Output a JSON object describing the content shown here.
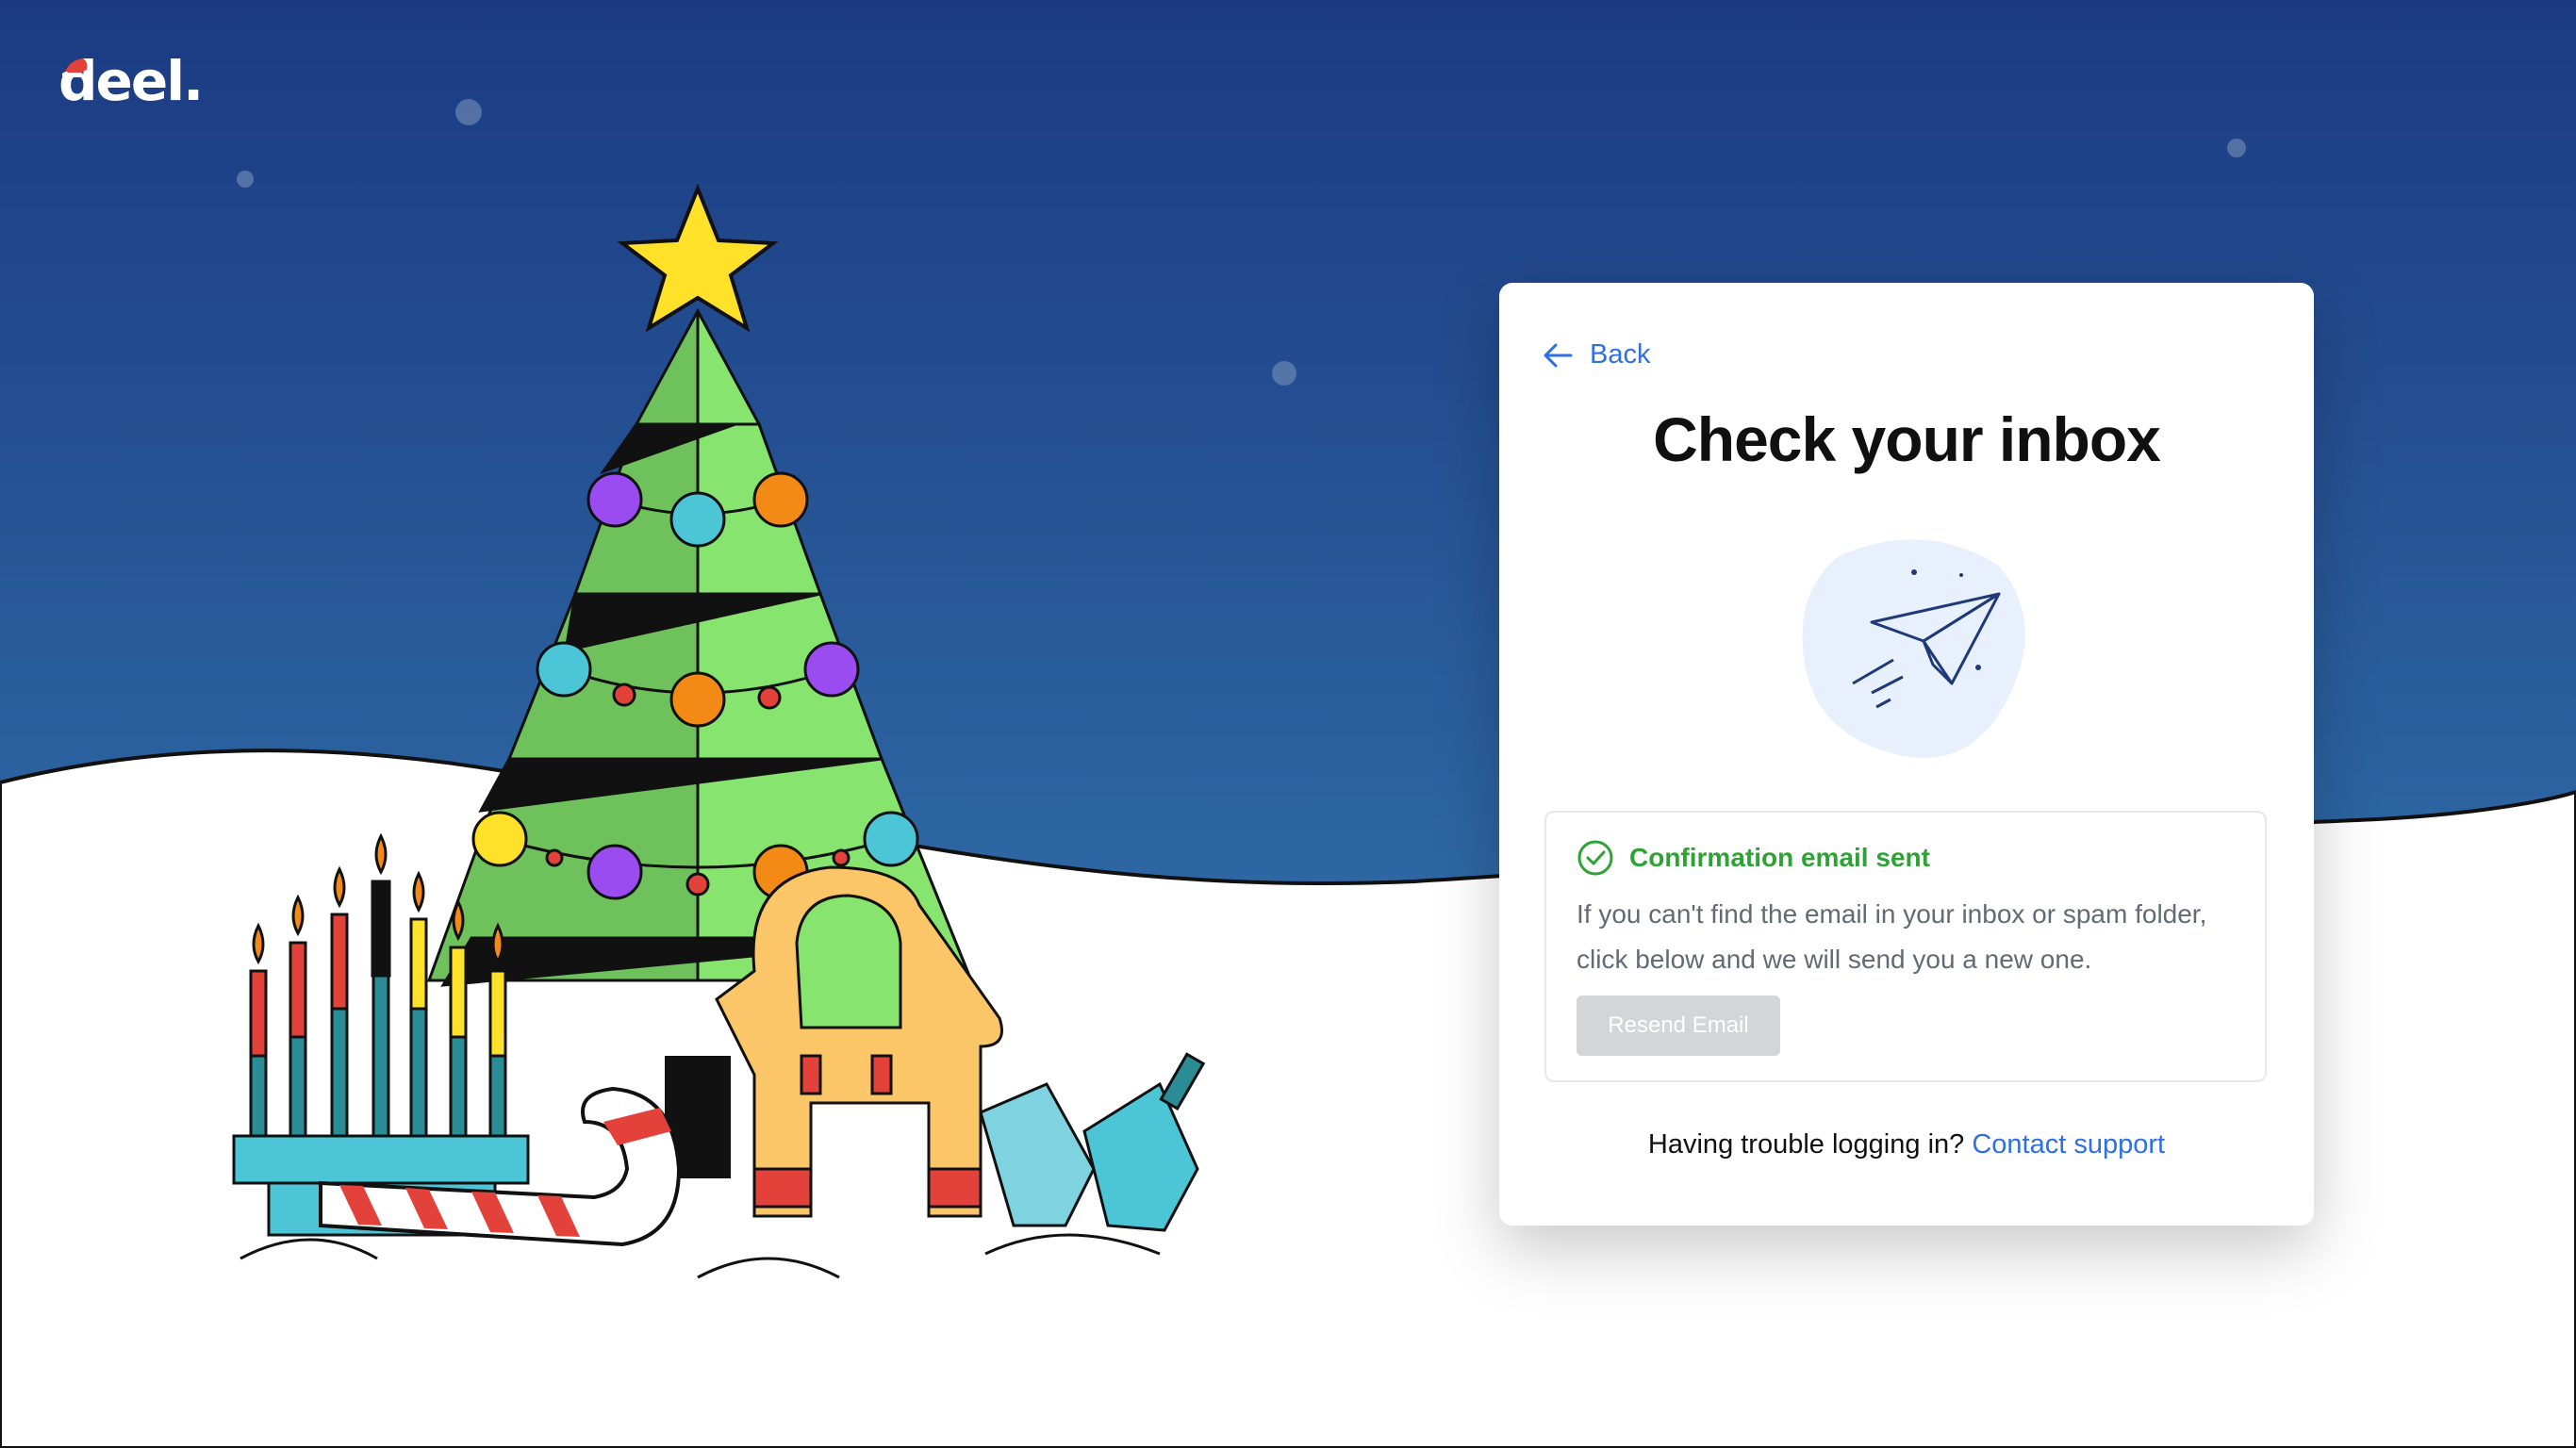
{
  "brand": {
    "logo_text": "deel."
  },
  "card": {
    "back_label": "Back",
    "title": "Check your inbox",
    "notice": {
      "heading": "Confirmation email sent",
      "body": "If you can't find the email in your inbox or spam folder, click below and we will send you a new one.",
      "button_label": "Resend Email"
    },
    "footer": {
      "question": "Having trouble logging in?",
      "link_label": "Contact support"
    }
  },
  "colors": {
    "sky_top": "#1b3a82",
    "sky_bottom": "#2f6aa6",
    "accent": "#2f6fe4",
    "success": "#2fa236",
    "button_disabled": "#d3d5d9"
  },
  "icons": [
    "arrow-left-icon",
    "paper-plane-icon",
    "check-circle-icon",
    "santa-hat-icon"
  ]
}
